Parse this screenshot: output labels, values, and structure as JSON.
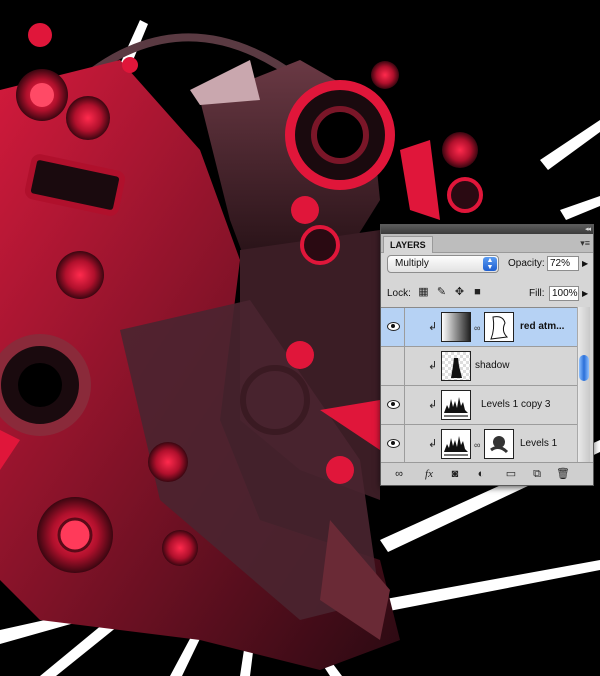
{
  "panel": {
    "tab_label": "LAYERS",
    "blend_mode": "Multiply",
    "opacity_label": "Opacity:",
    "opacity_value": "72%",
    "lock_label": "Lock:",
    "fill_label": "Fill:",
    "fill_value": "100%",
    "layers": [
      {
        "name": "red atm...",
        "selected": true
      },
      {
        "name": "shadow",
        "selected": false
      },
      {
        "name": "Levels 1 copy 3",
        "selected": false
      },
      {
        "name": "Levels 1",
        "selected": false
      }
    ],
    "footer_icons": [
      "link-layers-icon",
      "fx-icon",
      "layer-mask-icon",
      "adjustment-layer-icon",
      "new-group-icon",
      "new-layer-icon",
      "trash-icon"
    ]
  },
  "colors": {
    "accent_red": "#e0163a",
    "selection_blue": "#b6d2f4",
    "background": "#000000"
  }
}
